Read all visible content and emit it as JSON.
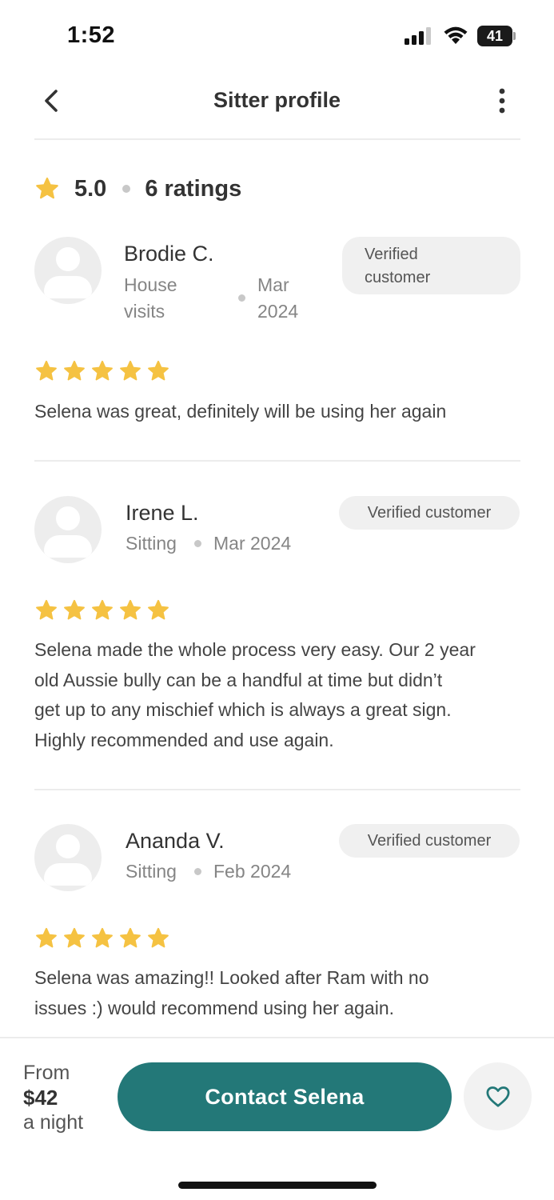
{
  "status_bar": {
    "time": "1:52",
    "battery": "41",
    "icons": [
      "cellular-signal-icon",
      "wifi-icon",
      "battery-icon"
    ]
  },
  "header": {
    "title": "Sitter profile",
    "back_icon": "chevron-left-icon",
    "more_icon": "more-vertical-icon"
  },
  "rating_summary": {
    "value": "5.0",
    "count": "6 ratings",
    "star_color": "#F5C242"
  },
  "reviews": [
    {
      "name": "Brodie C.",
      "service_line1": "House",
      "service_line2": "visits",
      "date_line1": "Mar",
      "date_line2": "2024",
      "badge_line1": "Verified",
      "badge_line2": "customer",
      "stars": 5,
      "text": "Selena was great, definitely will be using her again"
    },
    {
      "name": "Irene L.",
      "service": "Sitting",
      "date": "Mar 2024",
      "badge": "Verified customer",
      "stars": 5,
      "text_lines": [
        "Selena made the whole process very easy. Our 2 year",
        "old Aussie bully can be a handful at time but didn’t",
        "get up to any mischief which is always a great sign.",
        "Highly recommended and use again."
      ]
    },
    {
      "name": "Ananda V.",
      "service": "Sitting",
      "date": "Feb 2024",
      "badge": "Verified customer",
      "stars": 5,
      "text_lines": [
        "Selena was amazing!! Looked after Ram with no",
        "issues :) would recommend using her again."
      ]
    }
  ],
  "bottom_bar": {
    "price_from": "From",
    "price_amount": "$42",
    "price_unit": "a night",
    "contact_label": "Contact Selena",
    "favorite_icon": "heart-icon",
    "accent_color": "#237878"
  }
}
